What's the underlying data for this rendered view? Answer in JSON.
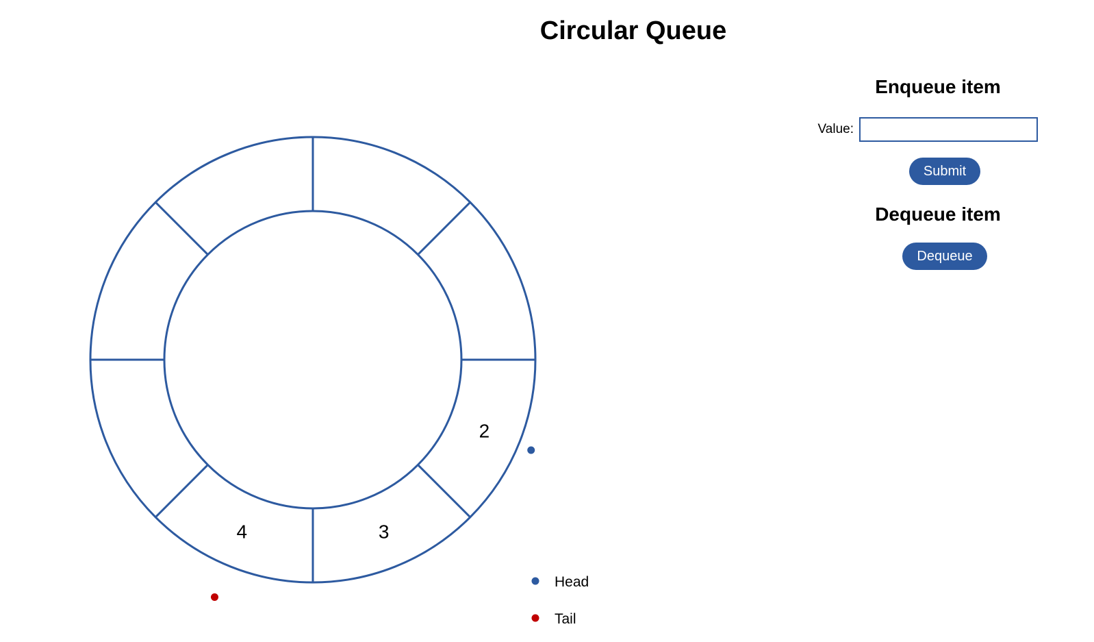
{
  "title": "Circular Queue",
  "queue": {
    "capacity": 8,
    "slots": [
      "",
      "",
      "2",
      "3",
      "4",
      "",
      "",
      ""
    ],
    "head_index": 2,
    "tail_index": 4,
    "ring_color": "#2d5aa0"
  },
  "legend": {
    "head_label": "Head",
    "tail_label": "Tail",
    "head_color": "#2d5aa0",
    "tail_color": "#c00000"
  },
  "enqueue": {
    "heading": "Enqueue item",
    "value_label": "Value:",
    "value": "",
    "placeholder": "",
    "submit_label": "Submit"
  },
  "dequeue": {
    "heading": "Dequeue item",
    "button_label": "Dequeue"
  },
  "colors": {
    "accent": "#2d5aa0",
    "button_text": "#ffffff"
  }
}
